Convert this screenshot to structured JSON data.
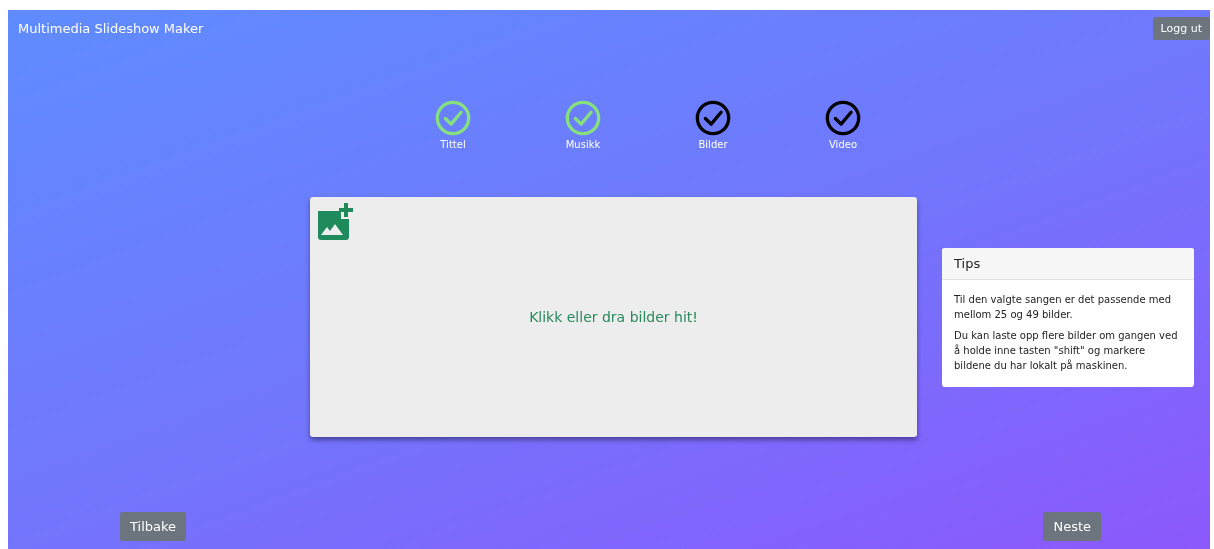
{
  "app_title": "Multimedia Slideshow Maker",
  "logout_button": "Logg ut",
  "steps": [
    {
      "label": "Tittel",
      "completed": true
    },
    {
      "label": "Musikk",
      "completed": true
    },
    {
      "label": "Bilder",
      "completed": false
    },
    {
      "label": "Video",
      "completed": false
    }
  ],
  "dropzone": {
    "text": "Klikk eller dra bilder hit!"
  },
  "tips": {
    "title": "Tips",
    "paragraphs": [
      "Til den valgte sangen er det passende med mellom 25 og 49 bilder.",
      "Du kan laste opp flere bilder om gangen ved å holde inne tasten \"shift\" og markere bildene du har lokalt på maskinen."
    ]
  },
  "back_button": "Tilbake",
  "next_button": "Neste"
}
